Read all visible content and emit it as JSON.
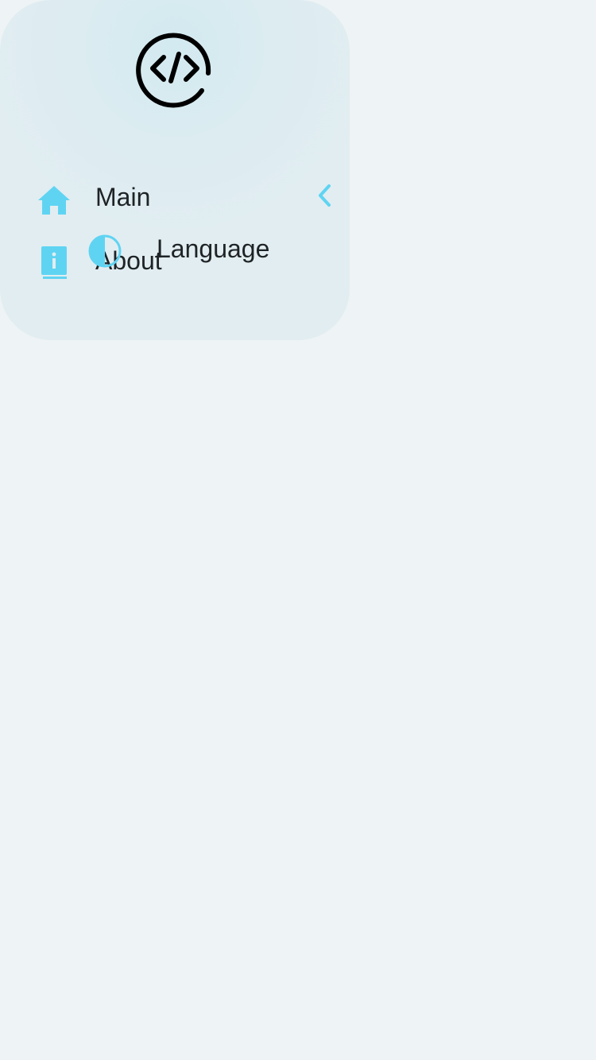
{
  "drawer": {
    "logo_icon": "code-circle-icon",
    "items": [
      {
        "label": "Main",
        "icon": "home-icon"
      },
      {
        "label": "About",
        "icon": "book-info-icon"
      },
      {
        "label": "Language",
        "icon": "contrast-half-circle-icon"
      }
    ],
    "collapse_icon": "chevron-left-icon"
  },
  "colors": {
    "accent": "#5fd4f2",
    "text": "#1e2326",
    "page_background": "#eef3f5",
    "drawer_background": "#e2edf1"
  }
}
